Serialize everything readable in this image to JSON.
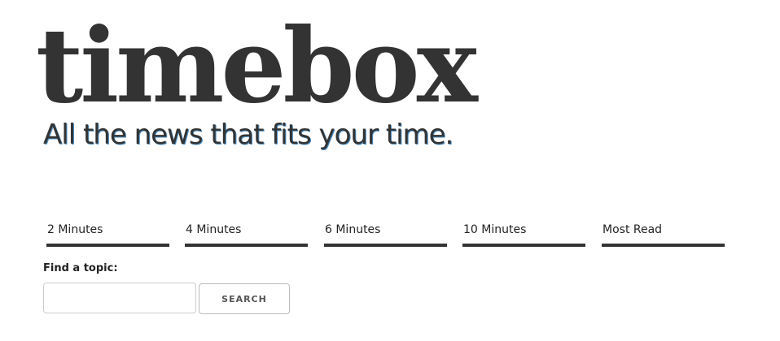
{
  "header": {
    "logo_text": "timebox",
    "tagline": "All the news that fits your time."
  },
  "tabs": [
    {
      "label": "2 Minutes"
    },
    {
      "label": "4 Minutes"
    },
    {
      "label": "6 Minutes"
    },
    {
      "label": "10 Minutes"
    },
    {
      "label": "Most Read"
    }
  ],
  "search": {
    "label": "Find a topic:",
    "value": "",
    "button_label": "SEARCH"
  },
  "colors": {
    "text": "#333333",
    "tagline_shadow": "#4a90c8",
    "tab_underline": "#333333",
    "background": "#ffffff"
  }
}
